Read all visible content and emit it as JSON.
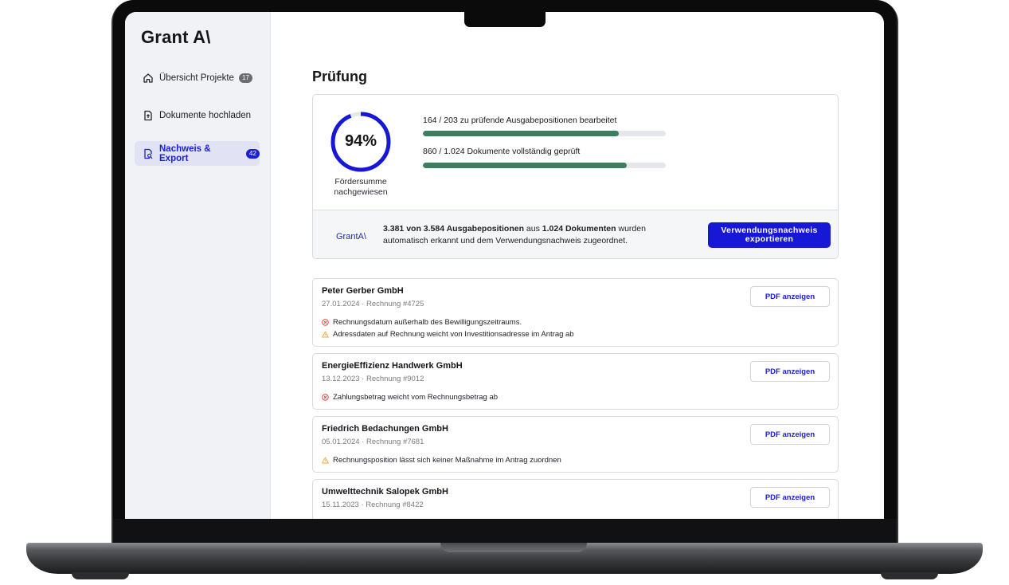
{
  "sidebar": {
    "logo": "Grant A\\",
    "items": [
      {
        "label": "Übersicht Projekte",
        "badge": "17",
        "icon": "home-icon",
        "active": false
      },
      {
        "label": "Dokumente hochladen",
        "badge": "",
        "icon": "upload-document-icon",
        "active": false
      },
      {
        "label": "Nachweis & Export",
        "badge": "42",
        "icon": "document-search-icon",
        "active": true
      }
    ]
  },
  "main": {
    "title": "Prüfung",
    "stats": {
      "percent": 94,
      "percent_label": "94%",
      "caption": "Fördersumme nachgewiesen",
      "metrics": [
        {
          "label": "164 / 203 zu prüfende Ausgabepositionen bearbeitet",
          "done": 164,
          "total": 203
        },
        {
          "label": "860 / 1.024 Dokumente vollständig geprüft",
          "done": 860,
          "total": 1024
        }
      ],
      "summary_logo": "GrantA\\",
      "summary": {
        "part1": "3.381 von 3.584 Ausgabepositionen",
        "part2": " aus ",
        "part3": "1.024 Dokumenten",
        "part4": " wurden automatisch erkannt und dem Verwendungsnachweis zugeordnet."
      },
      "export_label": "Verwendungsnachweis exportieren"
    },
    "invoices": [
      {
        "name": "Peter Gerber GmbH",
        "meta": "27.01.2024 · Rechnung #4725",
        "pdf_label": "PDF anzeigen",
        "issues": [
          {
            "type": "error",
            "text": "Rechnungsdatum außerhalb des Bewilligungszeitraums."
          },
          {
            "type": "warning",
            "text": "Adressdaten auf Rechnung weicht von Investitionsadresse im Antrag ab"
          }
        ]
      },
      {
        "name": "EnergieEffizienz Handwerk GmbH",
        "meta": "13.12.2023 · Rechnung #9012",
        "pdf_label": "PDF anzeigen",
        "issues": [
          {
            "type": "error",
            "text": "Zahlungsbetrag weicht vom Rechnungsbetrag ab"
          }
        ]
      },
      {
        "name": "Friedrich Bedachungen GmbH",
        "meta": "05.01.2024 · Rechnung #7681",
        "pdf_label": "PDF anzeigen",
        "issues": [
          {
            "type": "warning",
            "text": "Rechnungsposition lässt sich keiner Maßnahme im Antrag zuordnen"
          }
        ]
      },
      {
        "name": "Umwelttechnik Salopek GmbH",
        "meta": "15.11.2023 · Rechnung #8422",
        "pdf_label": "PDF anzeigen",
        "issues": []
      }
    ]
  },
  "colors": {
    "accent": "#1717d6",
    "progress": "#3c7f5e",
    "error": "#e0443c",
    "warning": "#f0a93a"
  }
}
